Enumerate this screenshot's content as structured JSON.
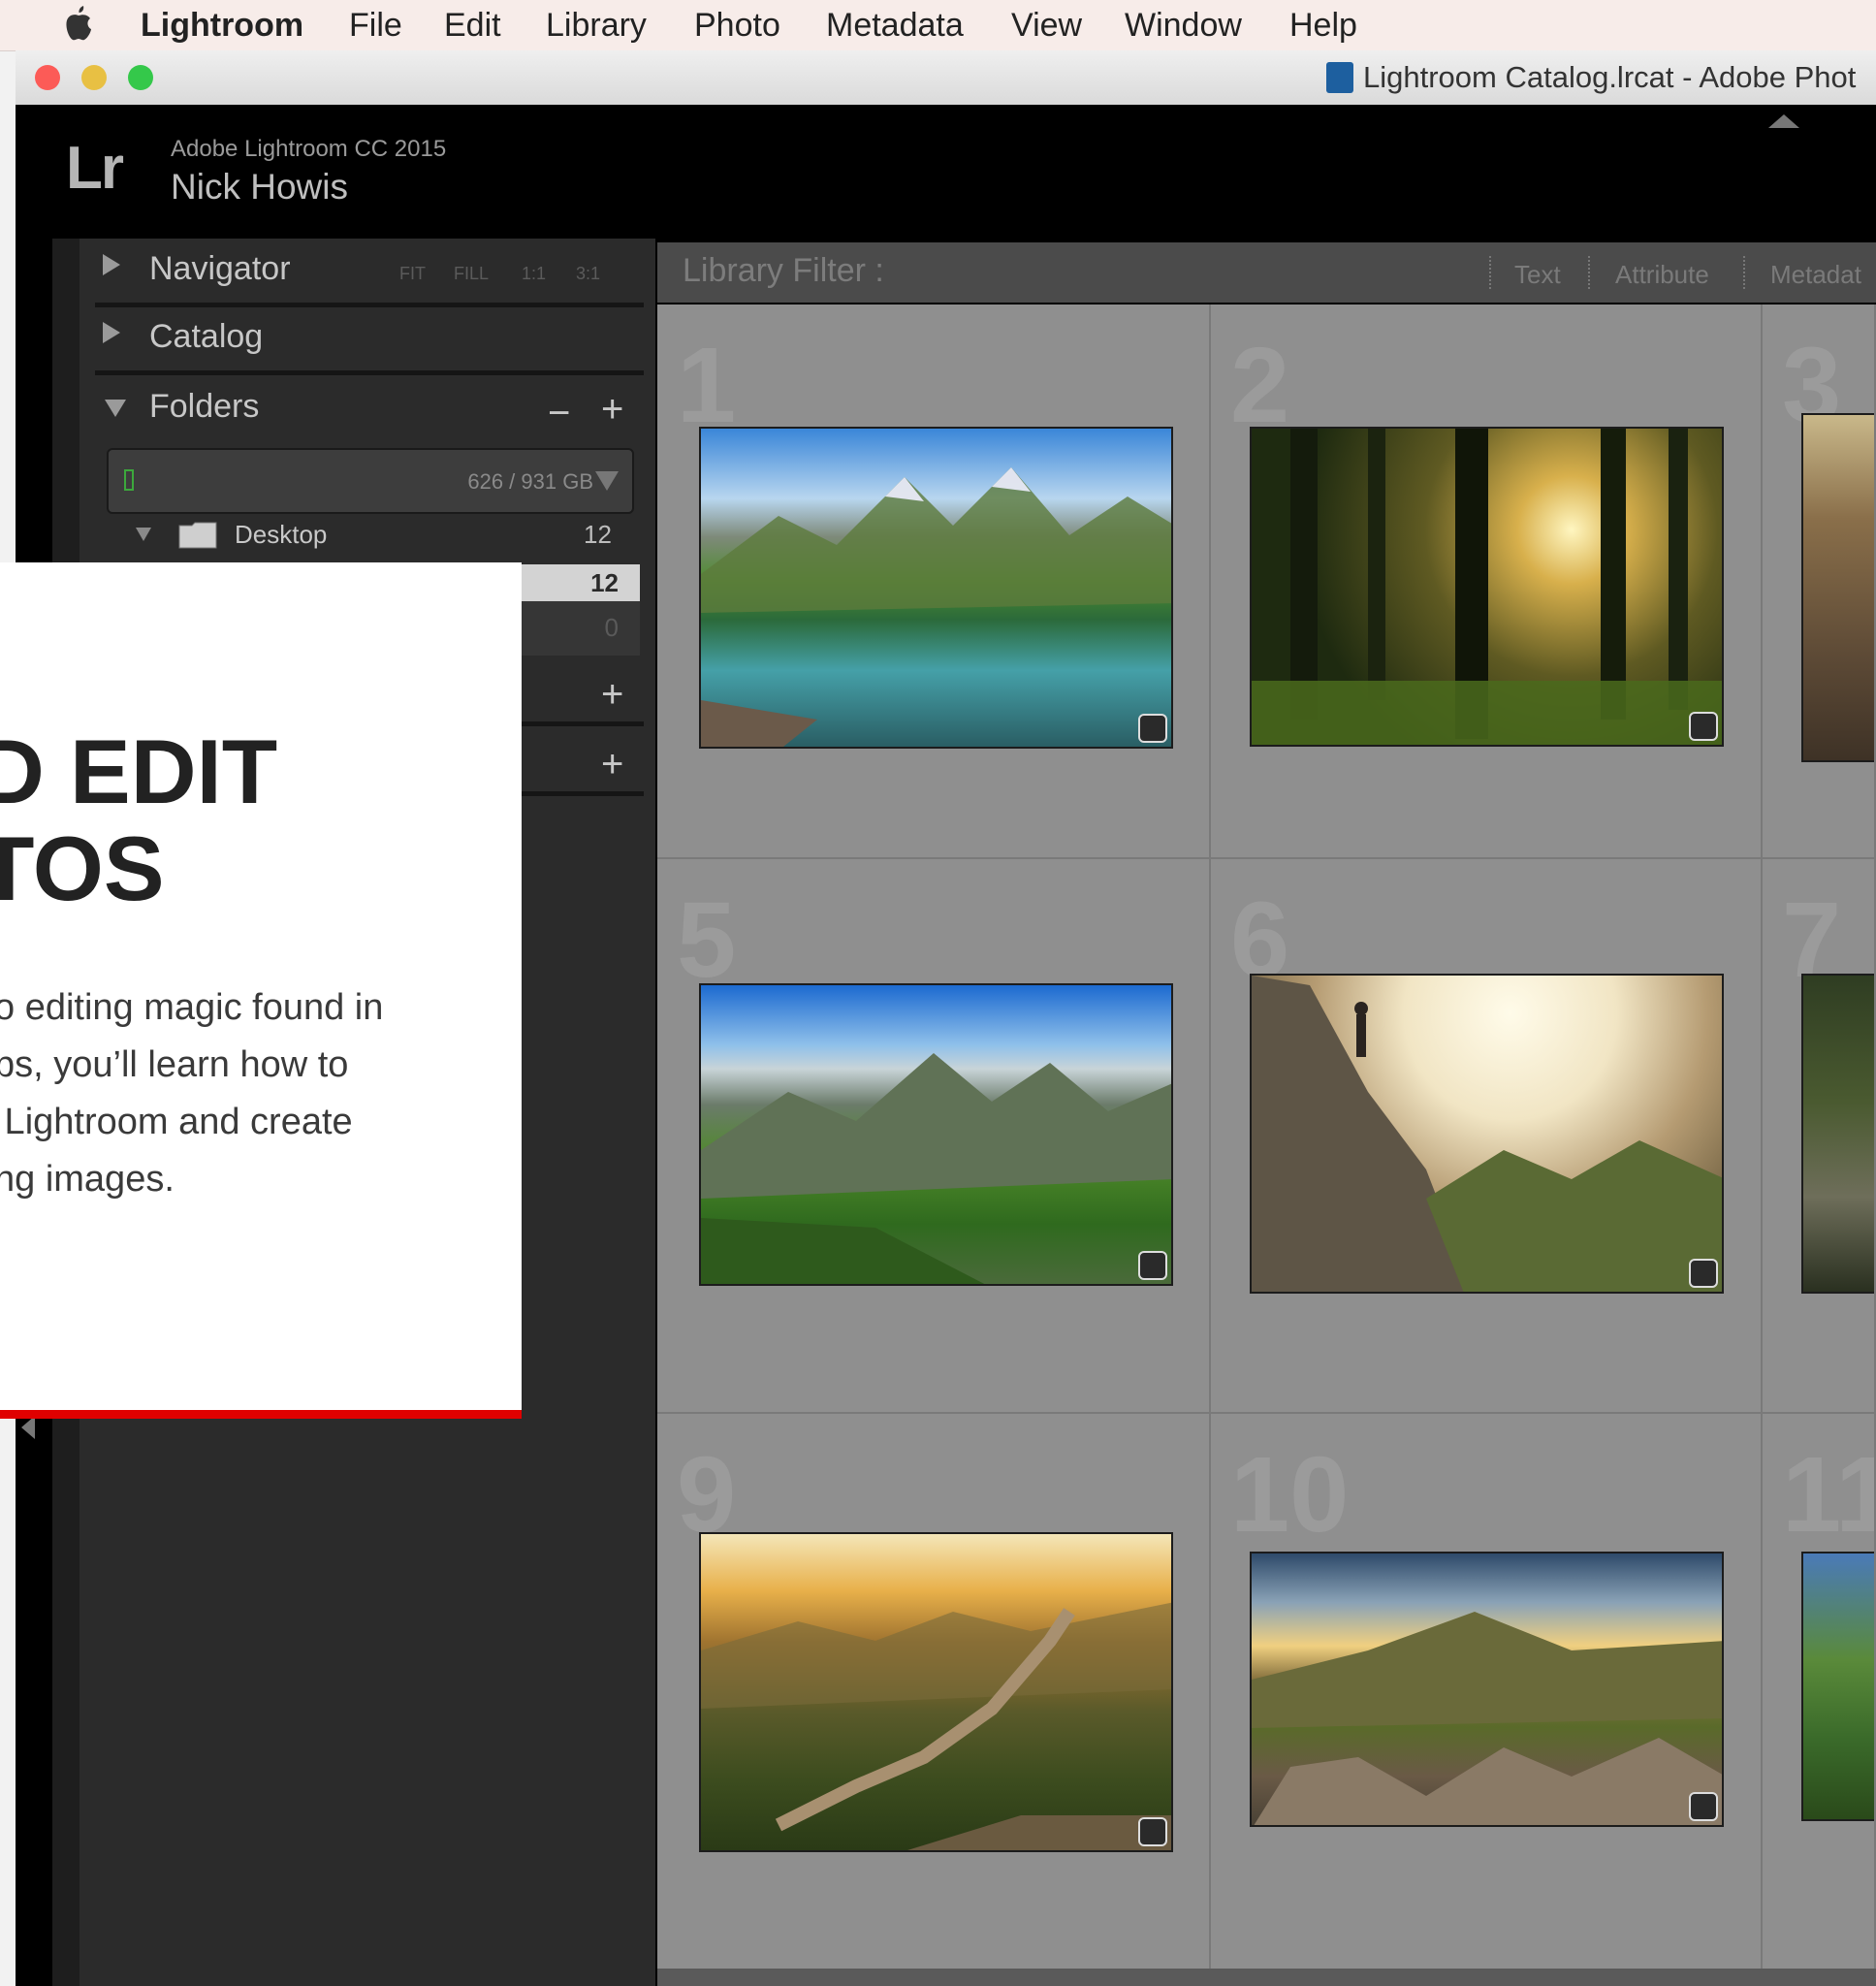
{
  "menubar": {
    "app_name": "Lightroom",
    "items": [
      "File",
      "Edit",
      "Library",
      "Photo",
      "Metadata",
      "View",
      "Window",
      "Help"
    ]
  },
  "window": {
    "title": "Lightroom Catalog.lrcat - Adobe Phot"
  },
  "identity": {
    "logo": "Lr",
    "version": "Adobe Lightroom CC 2015",
    "user": "Nick Howis"
  },
  "left_panel": {
    "navigator": "Navigator",
    "nav_zoom": [
      "FIT",
      "FILL",
      "1:1",
      "3:1"
    ],
    "catalog": "Catalog",
    "folders": "Folders",
    "folder_minus": "−",
    "folder_plus": "+",
    "drive_size": "626 / 931 GB",
    "desktop_label": "Desktop",
    "desktop_count": "12",
    "selected_count": "12",
    "dim_count": "0",
    "add_plus_1": "+",
    "add_plus_2": "+"
  },
  "filter": {
    "label": "Library Filter :",
    "options": [
      "Text",
      "Attribute",
      "Metadat"
    ]
  },
  "grid": {
    "cells": [
      {
        "num": "1"
      },
      {
        "num": "2"
      },
      {
        "num": "3"
      },
      {
        "num": "5"
      },
      {
        "num": "6"
      },
      {
        "num": "7"
      },
      {
        "num": "9"
      },
      {
        "num": "10"
      },
      {
        "num": "11"
      }
    ]
  },
  "overlay": {
    "title": "D EDIT\nTOS",
    "body": "o editing magic found in\nps, you’ll learn how to\n Lightroom and create\nng images."
  },
  "colors": {
    "accent_red": "#e00000",
    "panel_dark": "#2b2b2b",
    "grid_gray": "#8f8f8f"
  }
}
